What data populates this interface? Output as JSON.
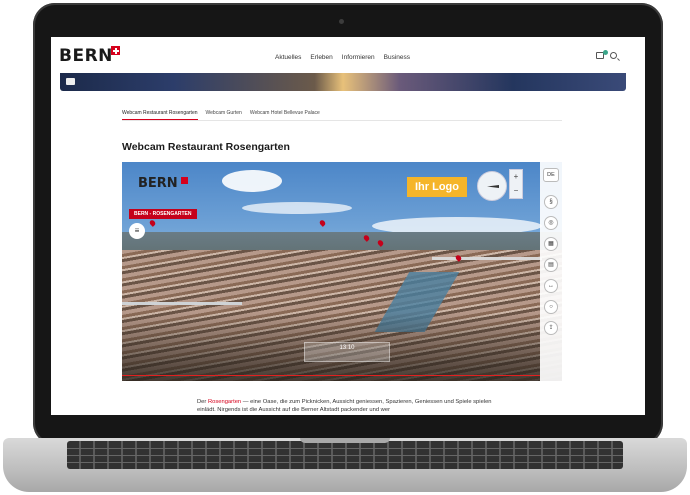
{
  "header": {
    "logo": "BERN",
    "nav": [
      "Aktuelles",
      "Erleben",
      "Informieren",
      "Business"
    ]
  },
  "tabs": [
    "Webcam Restaurant Rosengarten",
    "Webcam Gurten",
    "Webcam Hotel Bellevue Palace"
  ],
  "page_title": "Webcam Restaurant Rosengarten",
  "webcam": {
    "logo": "BERN",
    "location_label": "BERN - ROSENGARTEN",
    "ad_label": "Ihr Logo",
    "language": "DE",
    "zoom_in": "+",
    "zoom_out": "−",
    "time": "13:10"
  },
  "description": {
    "prefix": "Der ",
    "link": "Rosengarten",
    "text": " — eine Oase, die zum Picknicken, Aussicht geniessen, Spazieren, Geniessen und Spiele spielen einlädt. Nirgends ist die Aussicht auf die Berner Altstadt packender und wer"
  },
  "colors": {
    "brand_red": "#d6001c",
    "accent_yellow": "#f5b52a",
    "status_green": "#3aa68a"
  }
}
